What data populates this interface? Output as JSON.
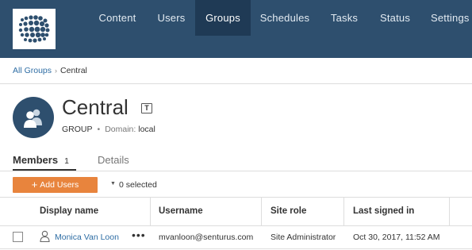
{
  "nav": {
    "items": [
      {
        "label": "Content"
      },
      {
        "label": "Users"
      },
      {
        "label": "Groups"
      },
      {
        "label": "Schedules"
      },
      {
        "label": "Tasks"
      },
      {
        "label": "Status"
      },
      {
        "label": "Settings"
      }
    ],
    "active": "Groups"
  },
  "breadcrumb": {
    "parent": "All Groups",
    "separator": "›",
    "current": "Central"
  },
  "header": {
    "title": "Central",
    "edit_glyph": "T",
    "type": "GROUP",
    "dot": "•",
    "domain_label": "Domain:",
    "domain_value": "local"
  },
  "tabs": {
    "members_label": "Members",
    "members_count": "1",
    "details_label": "Details",
    "active": "Members"
  },
  "toolbar": {
    "add_plus": "+",
    "add_label": "Add Users",
    "selection_caret": "▼",
    "selection_text": "0 selected"
  },
  "table": {
    "columns": [
      "Display name",
      "Username",
      "Site role",
      "Last signed in"
    ],
    "rows": [
      {
        "display_name": "Monica Van Loon",
        "more": "•••",
        "username": "mvanloon@senturus.com",
        "site_role": "Site Administrator",
        "last_signed_in": "Oct 30, 2017, 11:52 AM"
      }
    ]
  },
  "colors": {
    "nav_bg": "#2e4f6e",
    "nav_active_bg": "#1f3a55",
    "accent_orange": "#e8843d",
    "link_blue": "#2e6da4"
  },
  "icons": {
    "logo": "globe-logo-icon",
    "group": "group-users-icon",
    "edit": "edit-name-icon",
    "user": "user-outline-icon"
  }
}
